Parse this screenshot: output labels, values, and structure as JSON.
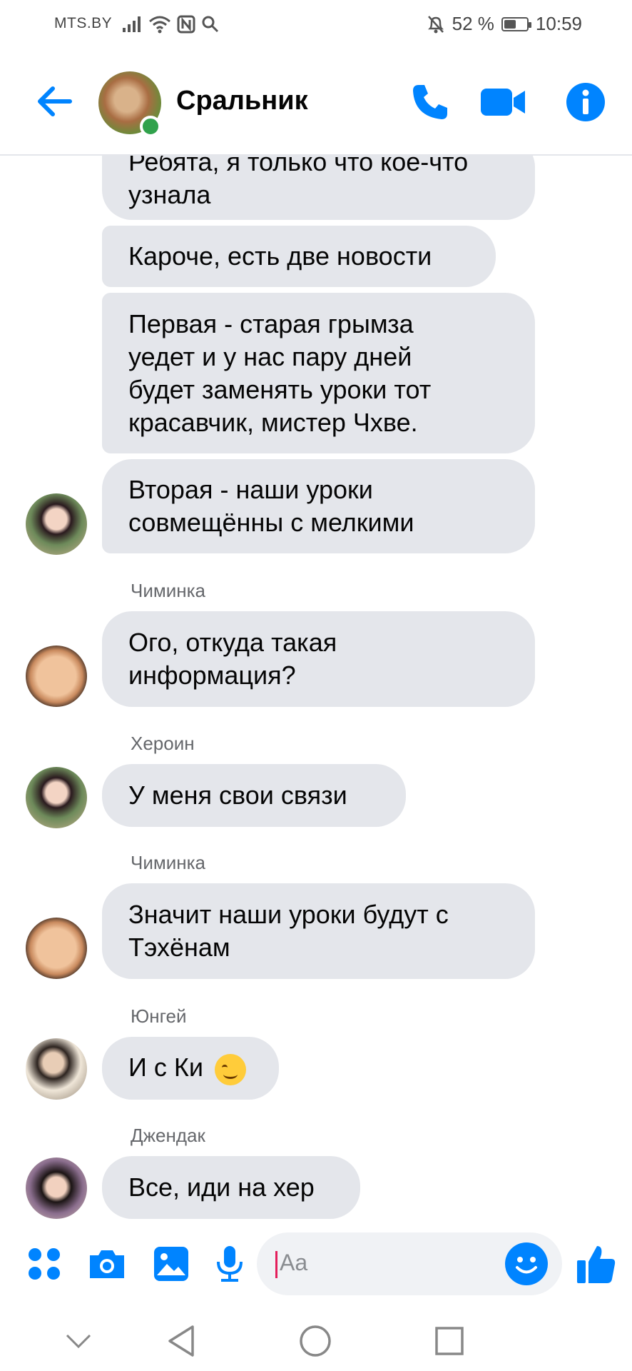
{
  "status_bar": {
    "carrier": "MTS.BY",
    "battery_text": "52 %",
    "battery_level": 0.52,
    "time": "10:59",
    "icons": [
      "signal-icon",
      "wifi-icon",
      "nfc-icon",
      "search-icon",
      "mute-icon",
      "battery-icon"
    ]
  },
  "header": {
    "title": "Сральник",
    "actions": [
      "phone-icon",
      "video-icon",
      "info-icon"
    ],
    "accent_color": "#0084ff",
    "online_color": "#31a24c"
  },
  "messages": [
    {
      "lines": [
        "Ребята, я только что кое-что",
        "узнала"
      ]
    },
    {
      "lines": [
        "Кароче, есть две новости"
      ]
    },
    {
      "lines": [
        "Первая - старая грымза",
        "уедет и у нас пару дней",
        "будет заменять уроки тот",
        "красавчик, мистер Чхве."
      ]
    },
    {
      "lines": [
        "Вторая - наши уроки",
        "совмещённы с мелкими"
      ]
    },
    {
      "sender": "Чиминка",
      "lines": [
        "Ого, откуда такая",
        "информация?"
      ]
    },
    {
      "sender": "Хероин",
      "lines": [
        "У меня свои связи"
      ]
    },
    {
      "sender": "Чиминка",
      "lines": [
        "Значит наши уроки будут с",
        "Тэхёнам"
      ]
    },
    {
      "sender": "Юнгей",
      "lines": [
        "И с Ки"
      ],
      "emoji": "smiling-face-emoji"
    },
    {
      "sender": "Джендак",
      "lines": [
        "Все, иди на хер"
      ]
    }
  ],
  "composer": {
    "placeholder": "Aa",
    "icons": [
      "apps-icon",
      "camera-icon",
      "gallery-icon",
      "microphone-icon",
      "emoji-icon",
      "like-icon"
    ]
  },
  "nav_bar": {
    "icons": [
      "chevron-down-icon",
      "back-triangle-icon",
      "home-circle-icon",
      "recents-square-icon"
    ]
  }
}
